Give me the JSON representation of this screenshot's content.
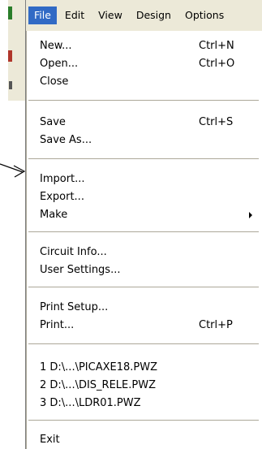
{
  "menubar": {
    "items": [
      {
        "label": "File"
      },
      {
        "label": "Edit"
      },
      {
        "label": "View"
      },
      {
        "label": "Design"
      },
      {
        "label": "Options"
      }
    ]
  },
  "file_menu": {
    "items": [
      {
        "label": "New...",
        "shortcut": "Ctrl+N"
      },
      {
        "label": "Open...",
        "shortcut": "Ctrl+O"
      },
      {
        "label": "Close",
        "shortcut": ""
      },
      {
        "label": "Save",
        "shortcut": "Ctrl+S"
      },
      {
        "label": "Save As...",
        "shortcut": ""
      },
      {
        "label": "Import...",
        "shortcut": ""
      },
      {
        "label": "Export...",
        "shortcut": ""
      },
      {
        "label": "Make",
        "shortcut": ""
      },
      {
        "label": "Circuit Info...",
        "shortcut": ""
      },
      {
        "label": "User Settings...",
        "shortcut": ""
      },
      {
        "label": "Print Setup...",
        "shortcut": ""
      },
      {
        "label": "Print...",
        "shortcut": "Ctrl+P"
      },
      {
        "label": "1 D:\\...\\PICAXE18.PWZ",
        "shortcut": ""
      },
      {
        "label": "2 D:\\...\\DIS_RELE.PWZ",
        "shortcut": ""
      },
      {
        "label": "3 D:\\...\\LDR01.PWZ",
        "shortcut": ""
      },
      {
        "label": "Exit",
        "shortcut": ""
      }
    ]
  },
  "colors": {
    "menu_highlight": "#316ac5",
    "menubar_bg": "#ece9d8"
  },
  "icons": {
    "submenu_indicator": "triangle-right-icon",
    "pointer": "arrow-icon"
  }
}
